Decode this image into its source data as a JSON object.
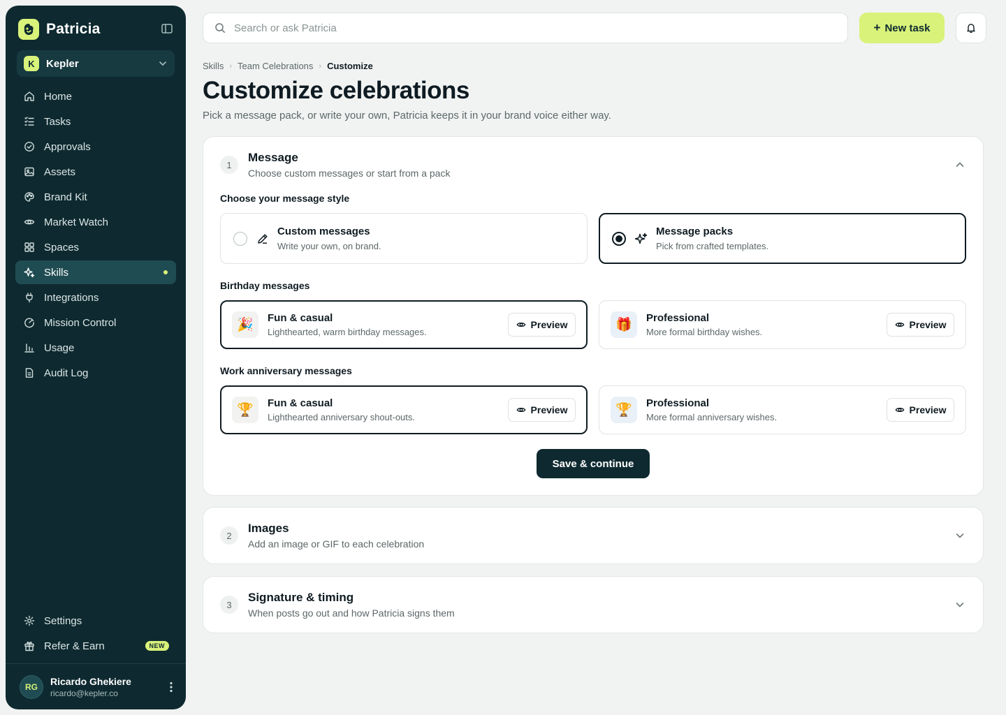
{
  "sidebar": {
    "brand": "Patricia",
    "workspace": {
      "initial": "K",
      "name": "Kepler"
    },
    "items": [
      {
        "label": "Home",
        "icon": "home-icon"
      },
      {
        "label": "Tasks",
        "icon": "list-icon"
      },
      {
        "label": "Approvals",
        "icon": "check-circle-icon"
      },
      {
        "label": "Assets",
        "icon": "image-icon"
      },
      {
        "label": "Brand Kit",
        "icon": "palette-icon"
      },
      {
        "label": "Market Watch",
        "icon": "eye-icon"
      },
      {
        "label": "Spaces",
        "icon": "grid-icon"
      },
      {
        "label": "Skills",
        "icon": "sparkle-icon",
        "active": true
      },
      {
        "label": "Integrations",
        "icon": "plug-icon"
      },
      {
        "label": "Mission Control",
        "icon": "gauge-icon"
      },
      {
        "label": "Usage",
        "icon": "bar-chart-icon"
      },
      {
        "label": "Audit Log",
        "icon": "document-icon"
      }
    ],
    "bottom": [
      {
        "label": "Settings",
        "icon": "gear-icon"
      },
      {
        "label": "Refer & Earn",
        "icon": "gift-icon",
        "badge": "NEW"
      }
    ],
    "user": {
      "initials": "RG",
      "name": "Ricardo Ghekiere",
      "email": "ricardo@kepler.co"
    }
  },
  "topbar": {
    "search_placeholder": "Search or ask Patricia",
    "new_task_label": "New task"
  },
  "breadcrumb": [
    "Skills",
    "Team Celebrations",
    "Customize"
  ],
  "page": {
    "title": "Customize celebrations",
    "subtitle": "Pick a message pack, or write your own, Patricia keeps it in your brand voice either way."
  },
  "steps": [
    {
      "number": "1",
      "title": "Message",
      "subtitle": "Choose custom messages or start from a pack",
      "expanded": true
    },
    {
      "number": "2",
      "title": "Images",
      "subtitle": "Add an image or GIF to each celebration",
      "expanded": false
    },
    {
      "number": "3",
      "title": "Signature & timing",
      "subtitle": "When posts go out and how Patricia signs them",
      "expanded": false
    }
  ],
  "message": {
    "style_label": "Choose your message style",
    "styles": [
      {
        "title": "Custom messages",
        "subtitle": "Write your own, on brand.",
        "selected": false
      },
      {
        "title": "Message packs",
        "subtitle": "Pick from crafted templates.",
        "selected": true
      }
    ],
    "birthday_label": "Birthday messages",
    "birthday_packs": [
      {
        "emoji": "🎉",
        "title": "Fun & casual",
        "subtitle": "Lighthearted, warm birthday messages.",
        "selected": true
      },
      {
        "emoji": "🎁",
        "title": "Professional",
        "subtitle": "More formal birthday wishes.",
        "selected": false
      }
    ],
    "anniversary_label": "Work anniversary messages",
    "anniversary_packs": [
      {
        "emoji": "🏆",
        "title": "Fun & casual",
        "subtitle": "Lighthearted anniversary shout-outs.",
        "selected": true
      },
      {
        "emoji": "🏆",
        "title": "Professional",
        "subtitle": "More formal anniversary wishes.",
        "selected": false
      }
    ],
    "preview_label": "Preview",
    "save_label": "Save & continue"
  },
  "colors": {
    "sidebar_bg": "#0e2a30",
    "accent": "#d9f27a",
    "page_bg": "#f1f3f2",
    "text": "#0f1b22"
  }
}
